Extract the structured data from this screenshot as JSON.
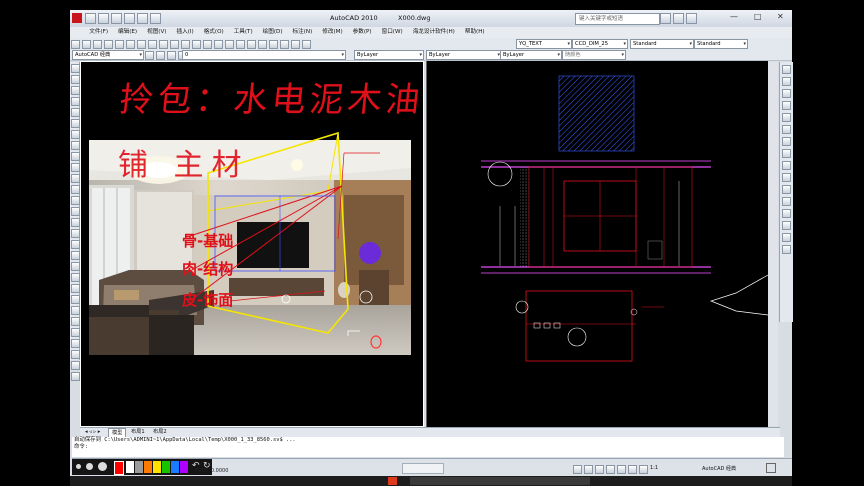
{
  "window": {
    "title_app": "AutoCAD 2010",
    "title_file": "X000.dwg",
    "search_placeholder": "键入关键字或短语"
  },
  "menu": [
    "文件(F)",
    "编辑(E)",
    "视图(V)",
    "插入(I)",
    "格式(O)",
    "工具(T)",
    "绘图(D)",
    "标注(N)",
    "修改(M)",
    "参数(P)",
    "窗口(W)",
    "海龙设计软件(H)",
    "帮助(H)"
  ],
  "toolbar2": {
    "layer_value": "0",
    "textstyle": "YQ_TEXT",
    "dimstyle": "CCD_DIM_25",
    "tablestyle": "Standard",
    "mleaderstyle": "Standard"
  },
  "toolbar3": {
    "workspace": "AutoCAD 经典",
    "color": "ByLayer",
    "linetype": "ByLayer",
    "lineweight": "ByLayer",
    "plotstyle": "随颜色"
  },
  "annotations": {
    "title_line": "拎包：水电泥木油",
    "sub_line": "铺 主材",
    "item1": "骨-基础",
    "item2": "肉-结构",
    "item3": "皮-饰面"
  },
  "layout_tabs": [
    "模型",
    "布局1",
    "布局2"
  ],
  "command": {
    "line1": "自动保存到 C:\\Users\\ADMINI~1\\AppData\\Local\\Temp\\X000_1_33_8560.sv$ ...",
    "line2": "命令:"
  },
  "status": {
    "coords": "7901, 0.0000",
    "workspace_label": "AutoCAD 经典",
    "scale": "1:1"
  },
  "colors": {
    "accent_yellow": "#f5e600",
    "line_red": "#e0101a",
    "purple": "#c040d0"
  }
}
